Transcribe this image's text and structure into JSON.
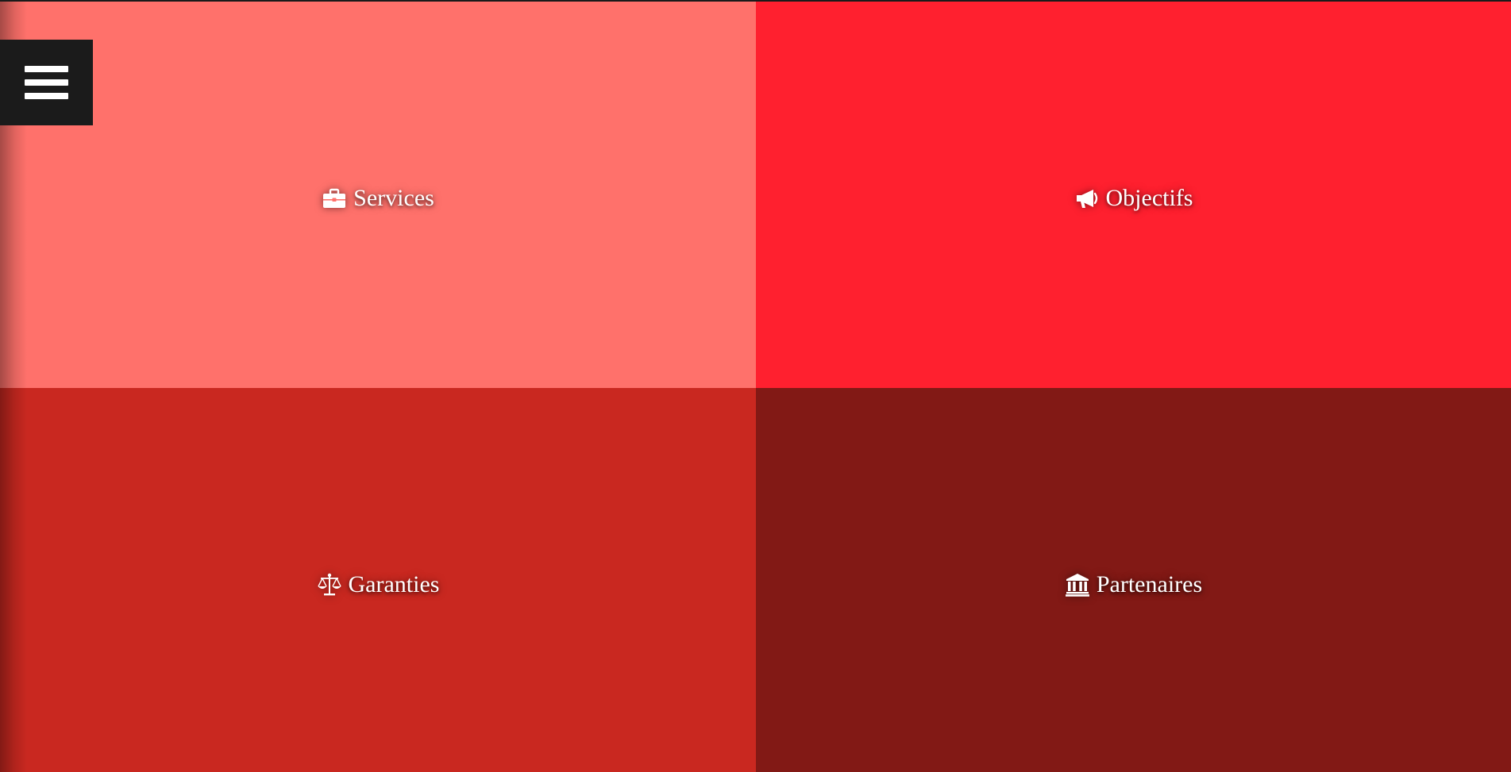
{
  "colors": {
    "tile_services": "#ff716b",
    "tile_objectifs": "#ff202f",
    "tile_garanties": "#c92820",
    "tile_partenaires": "#821915",
    "menu_bg": "#1b1b1b",
    "text": "#ffffff"
  },
  "menu": {
    "icon": "hamburger-menu-icon"
  },
  "tiles": [
    {
      "label": "Services",
      "icon": "briefcase-icon"
    },
    {
      "label": "Objectifs",
      "icon": "megaphone-icon"
    },
    {
      "label": "Garanties",
      "icon": "balance-scale-icon"
    },
    {
      "label": "Partenaires",
      "icon": "bank-building-icon"
    }
  ]
}
